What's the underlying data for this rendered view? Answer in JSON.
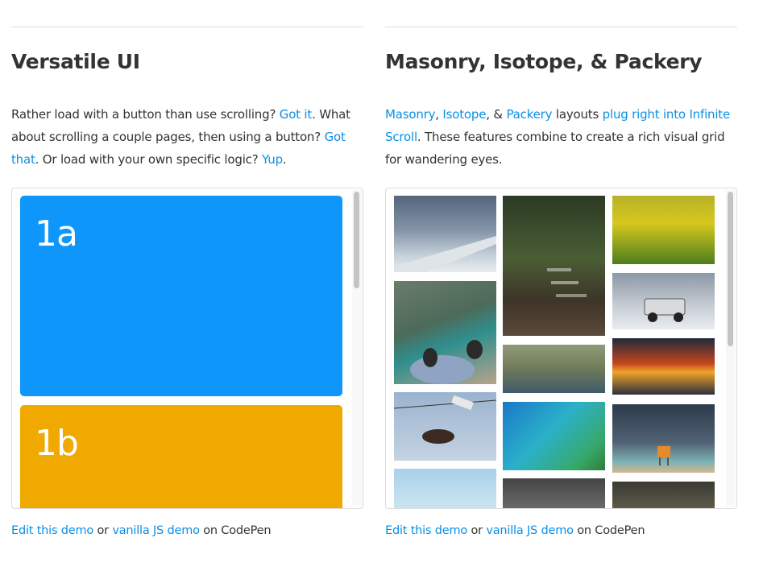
{
  "left": {
    "title": "Versatile UI",
    "desc": {
      "t1": "Rather load with a button than use scrolling? ",
      "link1": "Got it",
      "t2": ". What about scrolling a couple pages, then using a button? ",
      "link2": "Got that",
      "t3": ". Or load with your own specific logic? ",
      "link3": "Yup",
      "t4": "."
    },
    "panels": [
      {
        "label": "1a",
        "color": "#0e96fa"
      },
      {
        "label": "1b",
        "color": "#f0a900"
      }
    ],
    "footer": {
      "link1": "Edit this demo",
      "t1": " or ",
      "link2": "vanilla JS demo",
      "t2": " on CodePen"
    }
  },
  "right": {
    "title": "Masonry, Isotope, & Packery",
    "desc": {
      "link1": "Masonry",
      "t1": ", ",
      "link2": "Isotope",
      "t2": ", & ",
      "link3": "Packery",
      "t3": " layouts ",
      "link4": "plug right into Infinite Scroll",
      "t4": ". These features combine to create a rich visual grid for wandering eyes."
    },
    "footer": {
      "link1": "Edit this demo",
      "t1": " or ",
      "link2": "vanilla JS demo",
      "t2": " on CodePen"
    }
  },
  "colors": {
    "link": "#0b8fe6",
    "text": "#333333",
    "border": "#dddddd"
  }
}
